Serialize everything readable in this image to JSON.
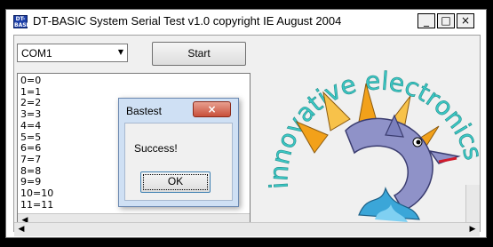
{
  "window": {
    "title": "DT-BASIC System Serial Test v1.0 copyright IE August 2004",
    "icon_label": "DT-BASIC",
    "minimize_glyph": "_",
    "maximize_glyph": "□",
    "close_glyph": "×"
  },
  "controls": {
    "port_select_value": "COM1",
    "start_label": "Start"
  },
  "output_lines": [
    "0=0",
    "1=1",
    "2=2",
    "3=3",
    "4=4",
    "5=5",
    "6=6",
    "7=7",
    "8=8",
    "9=9",
    "10=10",
    "11=11"
  ],
  "logo": {
    "text": "innovative electronics",
    "accent": "#3cc7c4"
  },
  "dialog": {
    "title": "Bastest",
    "message": "Success!",
    "ok_label": "OK",
    "close_glyph": "×"
  },
  "scroll": {
    "left_arrow": "◀",
    "right_arrow": "▶"
  }
}
